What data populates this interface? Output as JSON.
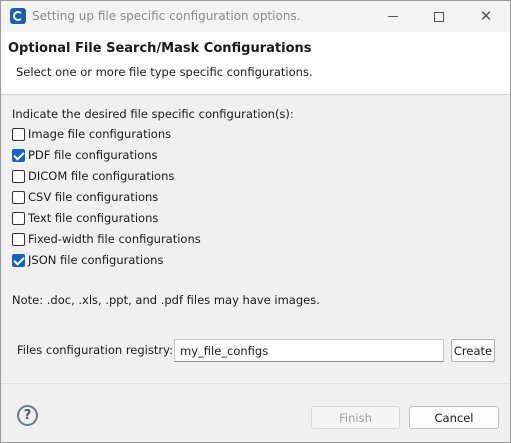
{
  "window": {
    "title": "Setting up file specific configuration options.",
    "app_icon": "app-logo-icon",
    "controls": {
      "minimize": "minimize-icon",
      "maximize": "maximize-icon",
      "close": "close-icon"
    }
  },
  "header": {
    "title": "Optional File Search/Mask Configurations",
    "subtitle": "Select one or more file type specific configurations."
  },
  "options": {
    "prompt": "Indicate the desired file specific configuration(s):",
    "items": [
      {
        "label": "Image file configurations",
        "checked": false
      },
      {
        "label": "PDF file configurations",
        "checked": true
      },
      {
        "label": "DICOM file configurations",
        "checked": false
      },
      {
        "label": "CSV file configurations",
        "checked": false
      },
      {
        "label": "Text file configurations",
        "checked": false
      },
      {
        "label": "Fixed-width file configurations",
        "checked": false
      },
      {
        "label": "JSON file configurations",
        "checked": true
      }
    ]
  },
  "note": "Note: .doc, .xls, .ppt, and .pdf files may have images.",
  "registry": {
    "label": "Files configuration registry:",
    "value": "my_file_configs",
    "create_label": "Create"
  },
  "footer": {
    "help_glyph": "?",
    "finish_label": "Finish",
    "cancel_label": "Cancel"
  },
  "colors": {
    "accent": "#1565c0",
    "disabled_text": "#a0a0a0"
  }
}
